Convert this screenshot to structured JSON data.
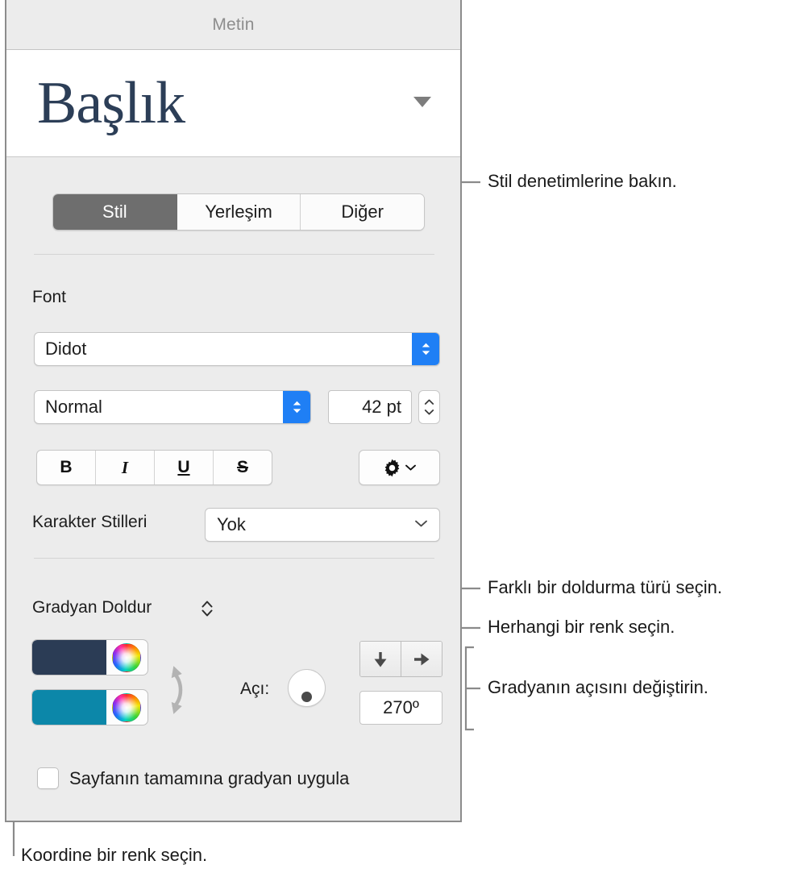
{
  "panel": {
    "header_title": "Metin",
    "preview": {
      "sample_text": "Başlık",
      "disclosure_icon": "triangle-down-icon"
    },
    "tabs": [
      {
        "label": "Stil",
        "active": true
      },
      {
        "label": "Yerleşim",
        "active": false
      },
      {
        "label": "Diğer",
        "active": false
      }
    ],
    "font_section": {
      "label": "Font",
      "family": {
        "value": "Didot",
        "icon": "updown-chevron-icon"
      },
      "weight": {
        "value": "Normal",
        "icon": "updown-chevron-icon"
      },
      "size": {
        "value": "42 pt",
        "stepper_icon": "updown-chevron-icon"
      },
      "format_buttons": [
        {
          "label": "B",
          "name": "bold-button"
        },
        {
          "label": "I",
          "name": "italic-button"
        },
        {
          "label": "U",
          "name": "underline-button"
        },
        {
          "label": "S",
          "name": "strikethrough-button"
        }
      ],
      "options_button": {
        "icon": "gear-icon",
        "chevron": "chevron-down-icon"
      },
      "character_styles": {
        "label": "Karakter Stilleri",
        "value": "Yok",
        "icon": "chevron-down-icon"
      }
    },
    "fill_section": {
      "type_label": "Gradyan Doldur",
      "type_icon": "updown-chevron-icon",
      "start_color": {
        "hex": "#2b3c55",
        "wheel_icon": "color-wheel-icon"
      },
      "end_color": {
        "hex": "#0c87a9",
        "wheel_icon": "color-wheel-icon"
      },
      "swap_icon": "swap-colors-icon",
      "angle_label": "Açı:",
      "angle_dial_icon": "angle-dial-icon",
      "direction_buttons": [
        {
          "icon": "arrow-down-icon",
          "name": "gradient-direction-down-button"
        },
        {
          "icon": "arrow-right-icon",
          "name": "gradient-direction-right-button"
        }
      ],
      "angle_value": "270º",
      "page_gradient_checkbox": {
        "label": "Sayfanın tamamına gradyan uygula",
        "checked": false
      }
    }
  },
  "callouts": [
    {
      "text": "Stil denetimlerine bakın."
    },
    {
      "text": "Farklı bir doldurma türü seçin."
    },
    {
      "text": "Herhangi bir renk seçin."
    },
    {
      "text": "Gradyanın açısını değiştirin."
    },
    {
      "text": "Koordine bir renk seçin."
    }
  ],
  "colors": {
    "panel_bg": "#ececec",
    "accent_blue": "#1f7ff5",
    "active_tab_bg": "#6e6e6e",
    "leader_line": "#8a8a8a"
  }
}
